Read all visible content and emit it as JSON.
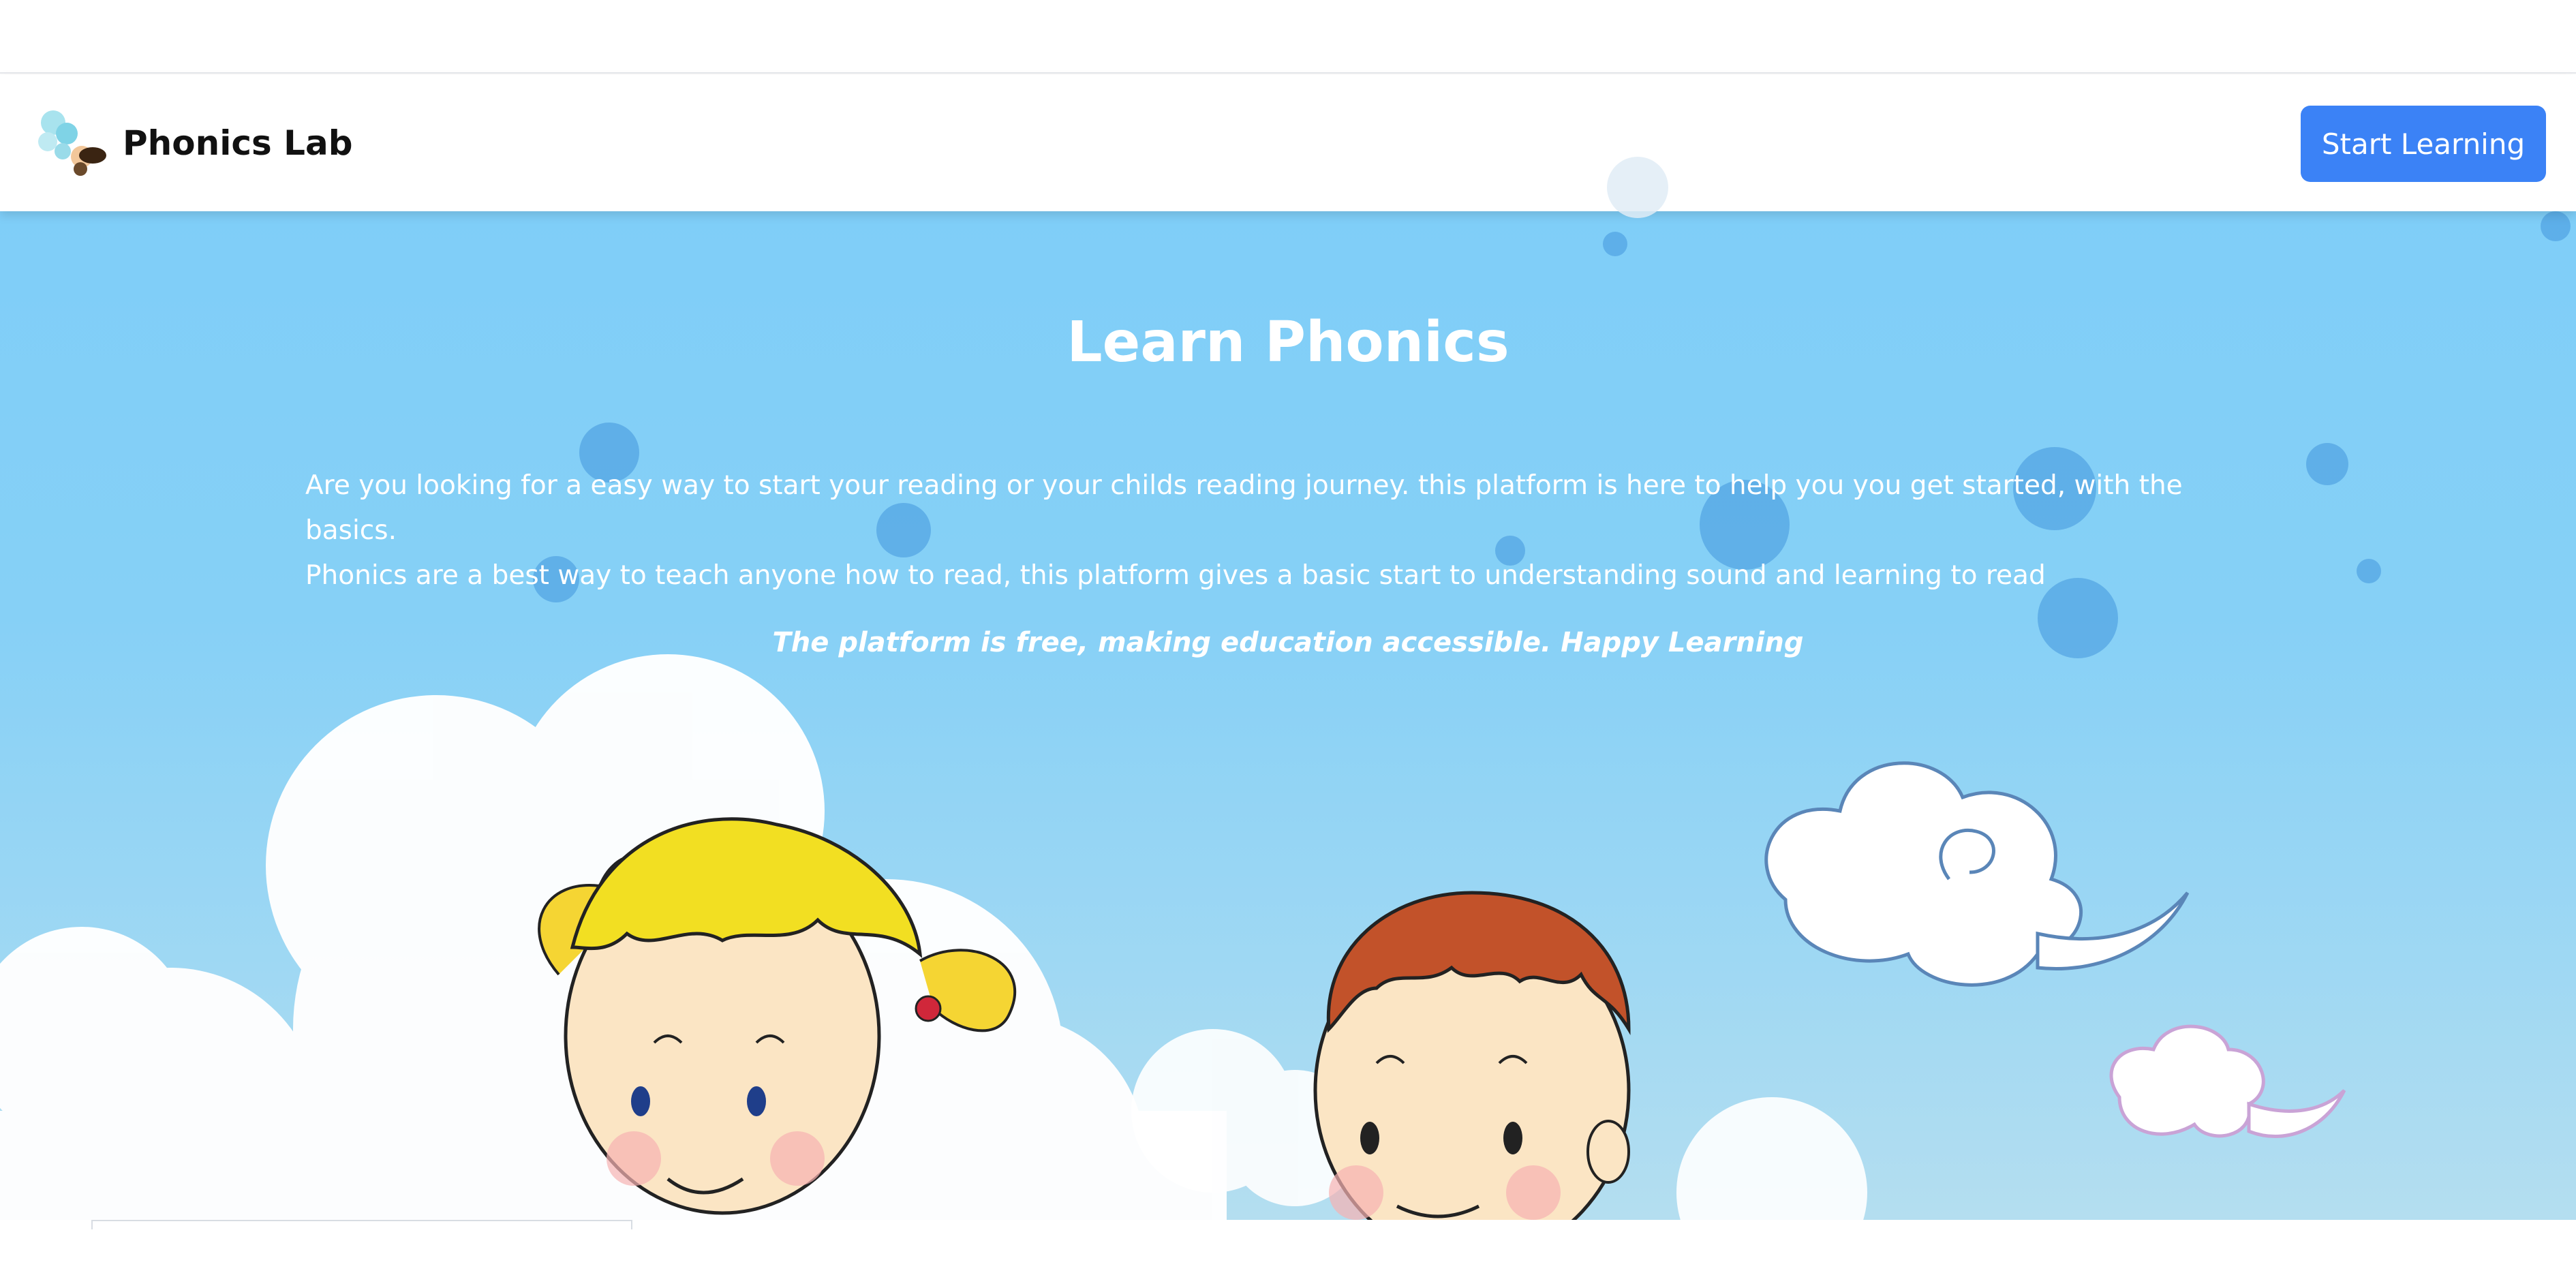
{
  "header": {
    "brand_name": "Phonics Lab",
    "brand_icon": "phonics-lab-logo",
    "cta_label": "Start Learning"
  },
  "hero": {
    "title": "Learn Phonics",
    "description_line1": "Are you looking for a easy way to start your reading or your childs reading journey. this platform is here to help you you get started, with the basics.",
    "description_line2": "Phonics are a best way to teach anyone how to read, this platform gives a basic start to understanding sound and learning to read",
    "note": "The platform is free, making education accessible. Happy Learning"
  },
  "colors": {
    "accent": "#3b82f6",
    "sky": "#7fcef8",
    "text_light": "#ffffff",
    "text_dark": "#111111"
  }
}
